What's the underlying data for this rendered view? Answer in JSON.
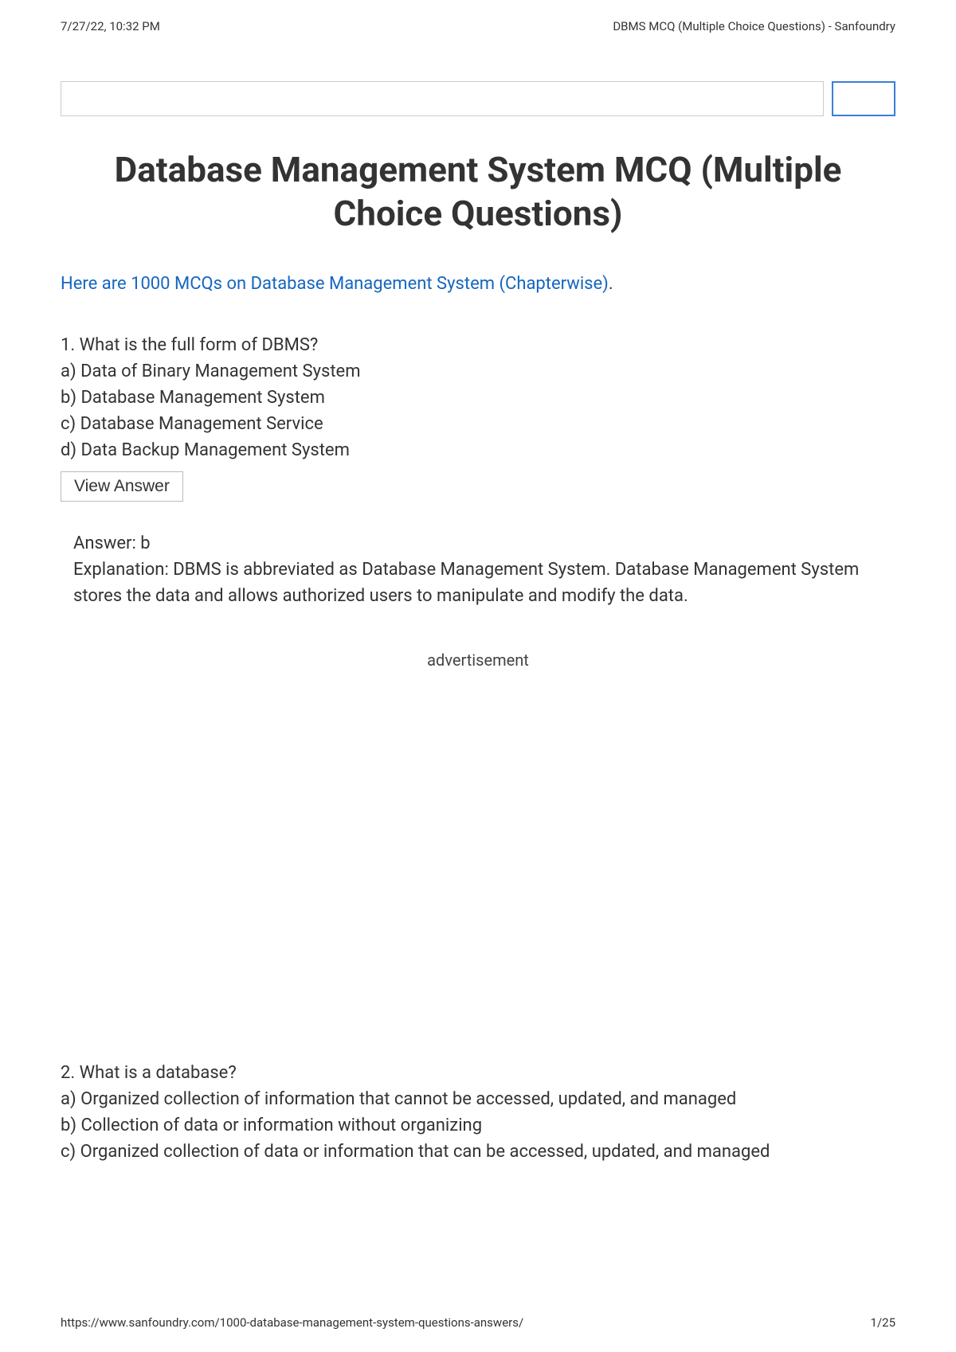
{
  "header": {
    "timestamp": "7/27/22, 10:32 PM",
    "doc_title": "DBMS MCQ (Multiple Choice Questions) - Sanfoundry"
  },
  "title": "Database Management System MCQ (Multiple Choice Questions)",
  "intro": {
    "link_text": "Here are 1000 MCQs on Database Management System (Chapterwise)",
    "trailing": "."
  },
  "q1": {
    "question": "1. What is the full form of DBMS?",
    "a": "a) Data of Binary Management System",
    "b": "b) Database Management System",
    "c": "c) Database Management Service",
    "d": "d) Data Backup Management System",
    "view_answer_label": "View Answer",
    "answer": "Answer: b",
    "explanation": "Explanation: DBMS is abbreviated as Database Management System. Database Management System stores the data and allows authorized users to manipulate and modify the data."
  },
  "ad_label": "advertisement",
  "q2": {
    "question": "2. What is a database?",
    "a": "a) Organized collection of information that cannot be accessed, updated, and managed",
    "b": "b) Collection of data or information without organizing",
    "c": "c) Organized collection of data or information that can be accessed, updated, and managed"
  },
  "footer": {
    "url": "https://www.sanfoundry.com/1000-database-management-system-questions-answers/",
    "page": "1/25"
  }
}
